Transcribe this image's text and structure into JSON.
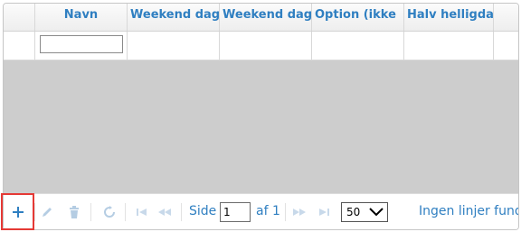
{
  "grid": {
    "columns": [
      {
        "label": ""
      },
      {
        "label": "Navn"
      },
      {
        "label": "Weekend dag"
      },
      {
        "label": "Weekend dag"
      },
      {
        "label": "Option (ikke"
      },
      {
        "label": "Halv helligda"
      },
      {
        "label": ""
      }
    ],
    "filter": {
      "navn_value": "",
      "navn_placeholder": ""
    }
  },
  "pager": {
    "page_label": "Side",
    "page_value": "1",
    "of_label": "af 1",
    "page_size": "50",
    "status": "Ingen linjer fundet"
  },
  "colors": {
    "accent": "#2f7fc1",
    "disabled_icon": "#b5cde3",
    "highlight": "#e53935",
    "empty_area": "#cdcdcd"
  },
  "icons": [
    "plus-icon",
    "pencil-icon",
    "trash-icon",
    "refresh-icon",
    "first-page-icon",
    "prev-page-icon",
    "next-page-icon",
    "last-page-icon",
    "chevron-down-icon"
  ]
}
